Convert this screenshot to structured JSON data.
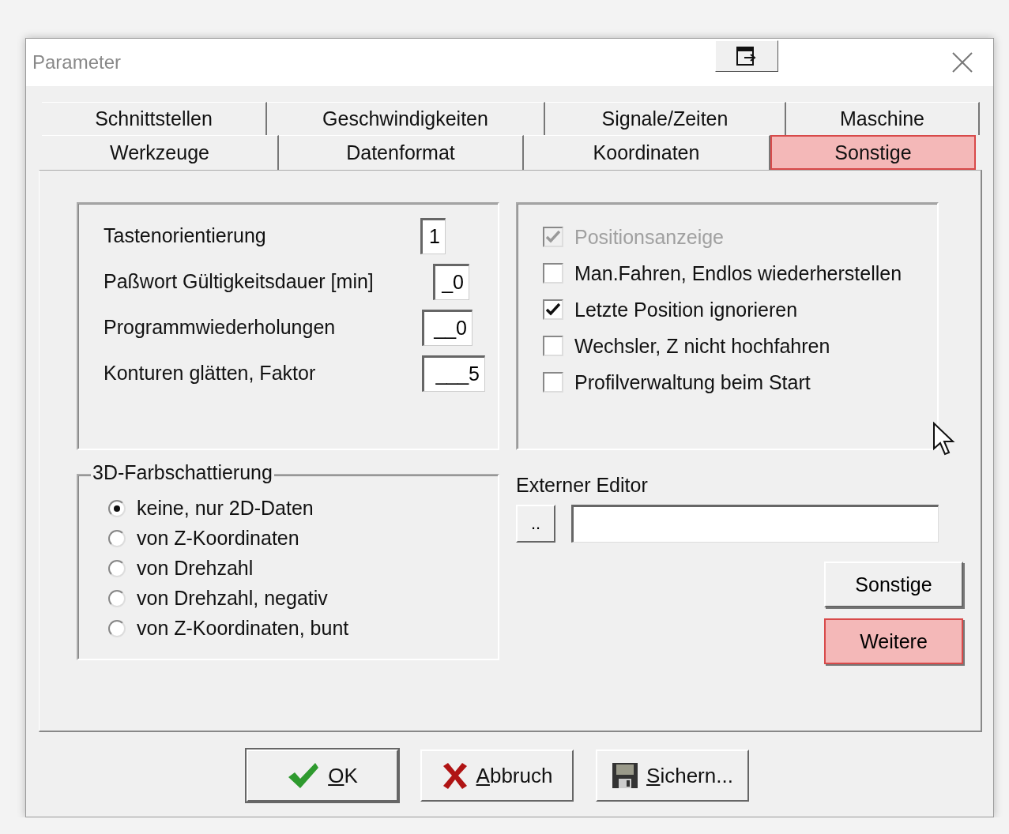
{
  "window": {
    "title": "Parameter"
  },
  "tab_rows": [
    [
      {
        "label": "Schnittstellen",
        "selected": false
      },
      {
        "label": "Geschwindigkeiten",
        "selected": false
      },
      {
        "label": "Signale/Zeiten",
        "selected": false
      },
      {
        "label": "Maschine",
        "selected": false
      }
    ],
    [
      {
        "label": "Werkzeuge",
        "selected": false
      },
      {
        "label": "Datenformat",
        "selected": false
      },
      {
        "label": "Koordinaten",
        "selected": false
      },
      {
        "label": "Sonstige",
        "selected": true
      }
    ]
  ],
  "fields": [
    {
      "label": "Tastenorientierung",
      "value": "1"
    },
    {
      "label": "Paßwort Gültigkeitsdauer [min]",
      "value": "_0"
    },
    {
      "label": "Programmwiederholungen",
      "value": "__0"
    },
    {
      "label": "Konturen glätten, Faktor",
      "value": "___5"
    }
  ],
  "options": [
    {
      "label": "Positionsanzeige",
      "checked": true,
      "disabled": true
    },
    {
      "label": "Man.Fahren, Endlos wiederherstellen",
      "checked": false,
      "disabled": false
    },
    {
      "label": "Letzte Position ignorieren",
      "checked": true,
      "disabled": false
    },
    {
      "label": "Wechsler, Z nicht hochfahren",
      "checked": false,
      "disabled": false
    },
    {
      "label": "Profilverwaltung beim Start",
      "checked": false,
      "disabled": false
    }
  ],
  "shading": {
    "title": "3D-Farbschattierung",
    "choices": [
      {
        "label": "keine, nur 2D-Daten",
        "selected": true
      },
      {
        "label": "von Z-Koordinaten",
        "selected": false
      },
      {
        "label": "von Drehzahl",
        "selected": false
      },
      {
        "label": "von Drehzahl, negativ",
        "selected": false
      },
      {
        "label": "von Z-Koordinaten, bunt",
        "selected": false
      }
    ]
  },
  "editor": {
    "label": "Externer Editor",
    "browse": ".."
  },
  "side_buttons": [
    {
      "label": "Sonstige",
      "highlighted": false
    },
    {
      "label": "Weitere",
      "highlighted": true
    }
  ],
  "footer_buttons": [
    {
      "kind": "ok",
      "label": "OK",
      "mnemonic_first": true
    },
    {
      "kind": "cancel",
      "label": "Abbruch",
      "mnemonic_first": true
    },
    {
      "kind": "save",
      "label": "Sichern...",
      "mnemonic_first": true
    }
  ]
}
